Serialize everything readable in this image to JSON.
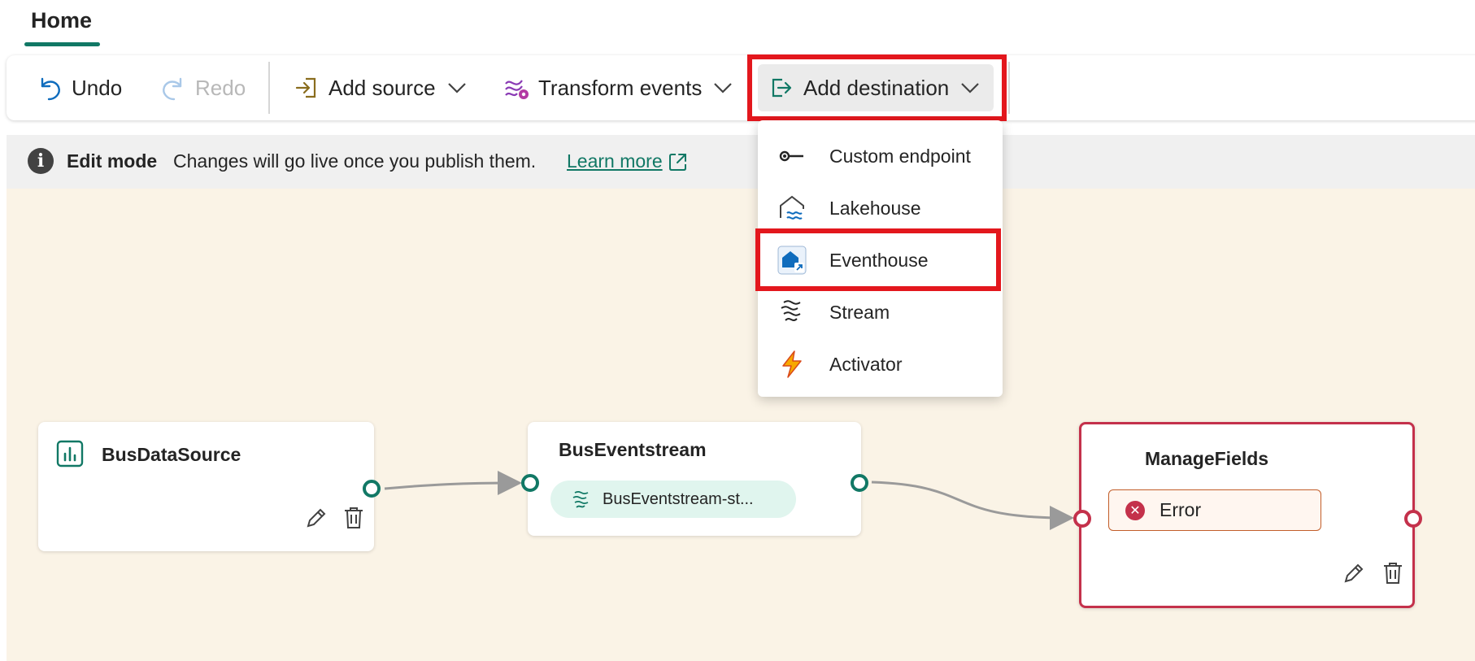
{
  "tabs": {
    "home": "Home"
  },
  "toolbar": {
    "undo": "Undo",
    "redo": "Redo",
    "add_source": "Add source",
    "transform_events": "Transform events",
    "add_destination": "Add destination"
  },
  "infobar": {
    "mode": "Edit mode",
    "message": "Changes will go live once you publish them.",
    "learn_more": "Learn more"
  },
  "destination_menu": {
    "items": [
      {
        "label": "Custom endpoint",
        "icon": "custom-endpoint-icon"
      },
      {
        "label": "Lakehouse",
        "icon": "lakehouse-icon"
      },
      {
        "label": "Eventhouse",
        "icon": "eventhouse-icon",
        "highlighted": true
      },
      {
        "label": "Stream",
        "icon": "stream-icon"
      },
      {
        "label": "Activator",
        "icon": "activator-icon"
      }
    ]
  },
  "nodes": {
    "source": {
      "title": "BusDataSource"
    },
    "eventstream": {
      "title": "BusEventstream",
      "stream_label": "BusEventstream-st..."
    },
    "manage_fields": {
      "title": "ManageFields",
      "status": "Error"
    }
  },
  "colors": {
    "accent": "#117865",
    "highlight": "#e3171d",
    "error": "#c4314b",
    "canvas": "#faf3e6"
  }
}
